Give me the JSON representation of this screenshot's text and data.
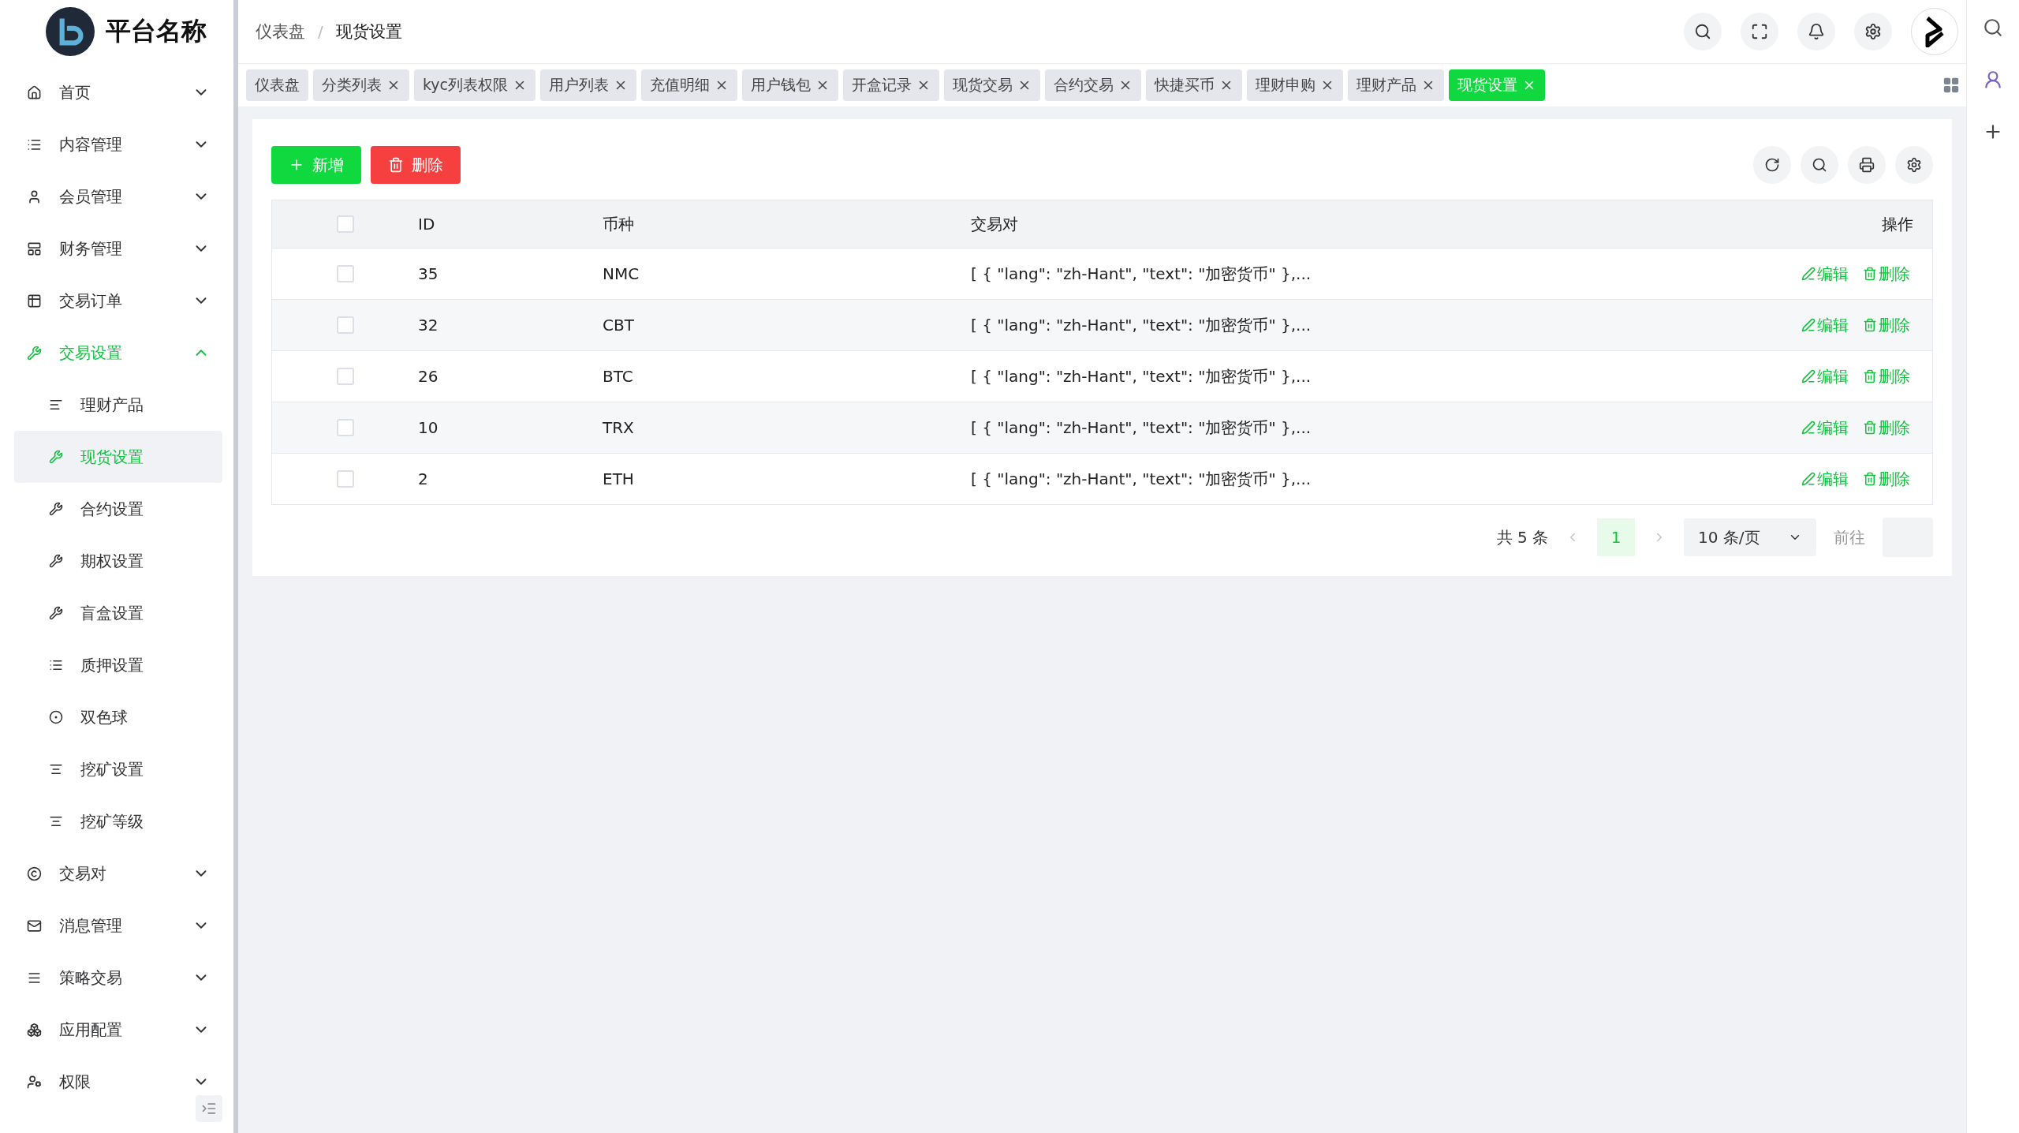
{
  "header": {
    "title": "平台名称",
    "breadcrumb": [
      "仪表盘",
      "现货设置"
    ],
    "breadcrumb_separator": "/"
  },
  "sidebar": {
    "items": [
      {
        "label": "首页",
        "expanded": false
      },
      {
        "label": "内容管理",
        "expanded": false
      },
      {
        "label": "会员管理",
        "expanded": false
      },
      {
        "label": "财务管理",
        "expanded": false
      },
      {
        "label": "交易订单",
        "expanded": false
      },
      {
        "label": "交易设置",
        "expanded": true,
        "children": [
          {
            "label": "理财产品",
            "selected": false
          },
          {
            "label": "现货设置",
            "selected": true
          },
          {
            "label": "合约设置",
            "selected": false
          },
          {
            "label": "期权设置",
            "selected": false
          },
          {
            "label": "盲盒设置",
            "selected": false
          },
          {
            "label": "质押设置",
            "selected": false
          },
          {
            "label": "双色球",
            "selected": false
          },
          {
            "label": "挖矿设置",
            "selected": false
          },
          {
            "label": "挖矿等级",
            "selected": false
          }
        ]
      },
      {
        "label": "交易对",
        "expanded": false
      },
      {
        "label": "消息管理",
        "expanded": false
      },
      {
        "label": "策略交易",
        "expanded": false
      },
      {
        "label": "应用配置",
        "expanded": false
      },
      {
        "label": "权限",
        "expanded": false
      }
    ]
  },
  "tabs": [
    {
      "label": "仪表盘",
      "closable": false,
      "selected": false
    },
    {
      "label": "分类列表",
      "closable": true,
      "selected": false
    },
    {
      "label": "kyc列表权限",
      "closable": true,
      "selected": false
    },
    {
      "label": "用户列表",
      "closable": true,
      "selected": false
    },
    {
      "label": "充值明细",
      "closable": true,
      "selected": false
    },
    {
      "label": "用户钱包",
      "closable": true,
      "selected": false
    },
    {
      "label": "开盒记录",
      "closable": true,
      "selected": false
    },
    {
      "label": "现货交易",
      "closable": true,
      "selected": false
    },
    {
      "label": "合约交易",
      "closable": true,
      "selected": false
    },
    {
      "label": "快捷买币",
      "closable": true,
      "selected": false
    },
    {
      "label": "理财申购",
      "closable": true,
      "selected": false
    },
    {
      "label": "理财产品",
      "closable": true,
      "selected": false
    },
    {
      "label": "现货设置",
      "closable": true,
      "selected": true
    }
  ],
  "actions": [
    {
      "label": "新增",
      "kind": "add"
    },
    {
      "label": "删除",
      "kind": "delete"
    }
  ],
  "table": {
    "header_checked": false,
    "columns": [
      "ID",
      "币种",
      "交易对",
      "操作"
    ],
    "rows": [
      {
        "checked": false,
        "id": "35",
        "coin": "NMC",
        "pair": "[ { \"lang\": \"zh-Hant\", \"text\": \"加密货币\" },...",
        "actions": [
          "编辑",
          "删除"
        ]
      },
      {
        "checked": false,
        "id": "32",
        "coin": "CBT",
        "pair": "[ { \"lang\": \"zh-Hant\", \"text\": \"加密货币\" },...",
        "actions": [
          "编辑",
          "删除"
        ]
      },
      {
        "checked": false,
        "id": "26",
        "coin": "BTC",
        "pair": "[ { \"lang\": \"zh-Hant\", \"text\": \"加密货币\" },...",
        "actions": [
          "编辑",
          "删除"
        ]
      },
      {
        "checked": false,
        "id": "10",
        "coin": "TRX",
        "pair": "[ { \"lang\": \"zh-Hant\", \"text\": \"加密货币\" },...",
        "actions": [
          "编辑",
          "删除"
        ]
      },
      {
        "checked": false,
        "id": "2",
        "coin": "ETH",
        "pair": "[ { \"lang\": \"zh-Hant\", \"text\": \"加密货币\" },...",
        "actions": [
          "编辑",
          "删除"
        ]
      }
    ]
  },
  "pagination": {
    "total": "共 5 条",
    "pages": [
      {
        "label": "1",
        "selected": true
      }
    ],
    "page_size": "10 条/页",
    "goto": "前往"
  }
}
